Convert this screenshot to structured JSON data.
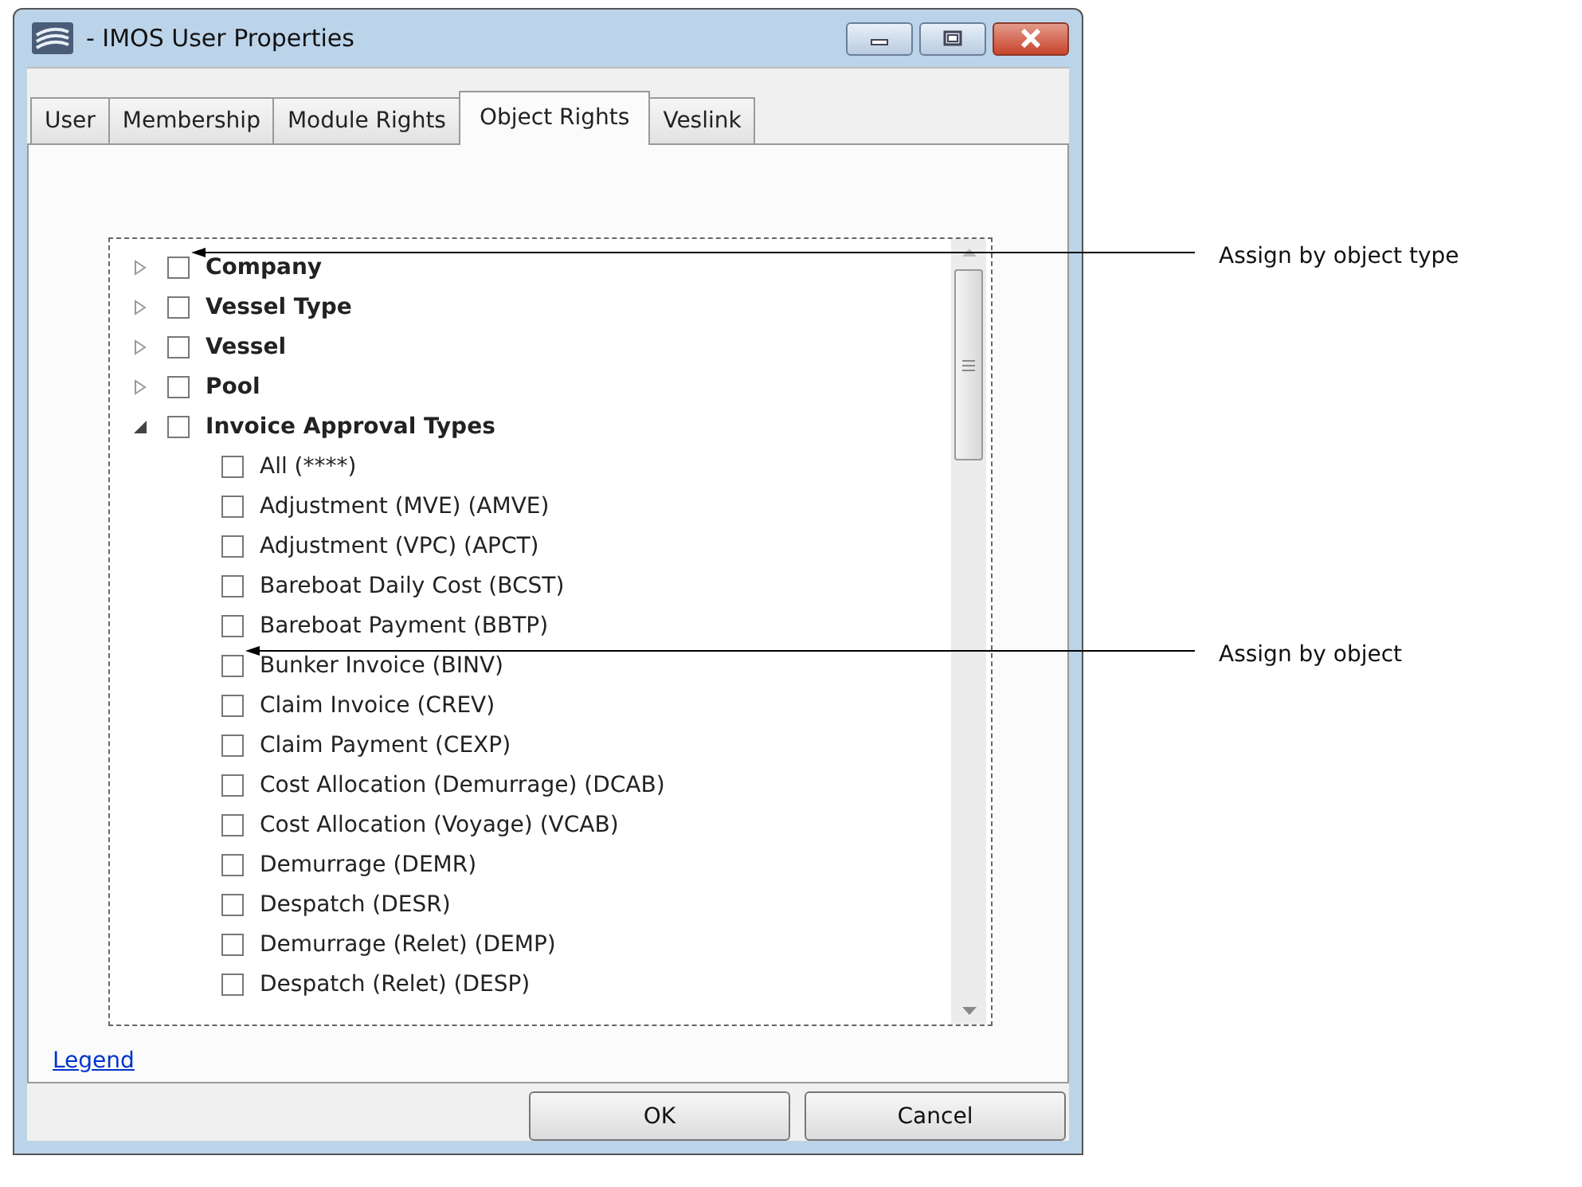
{
  "window": {
    "title": "- IMOS User Properties"
  },
  "tabs": [
    {
      "label": "User",
      "selected": false
    },
    {
      "label": "Membership",
      "selected": false
    },
    {
      "label": "Module Rights",
      "selected": false
    },
    {
      "label": "Object Rights",
      "selected": true
    },
    {
      "label": "Veslink",
      "selected": false
    }
  ],
  "tree": [
    {
      "label": "Company",
      "checked": false,
      "expanded": false,
      "annotation": "Assign by object type"
    },
    {
      "label": "Vessel Type",
      "checked": false,
      "expanded": false
    },
    {
      "label": "Vessel",
      "checked": false,
      "expanded": false
    },
    {
      "label": "Pool",
      "checked": false,
      "expanded": false
    },
    {
      "label": "Invoice Approval Types",
      "checked": false,
      "expanded": true,
      "children": [
        {
          "label": "All (****)",
          "checked": false
        },
        {
          "label": "Adjustment (MVE) (AMVE)",
          "checked": false
        },
        {
          "label": "Adjustment (VPC) (APCT)",
          "checked": false
        },
        {
          "label": "Bareboat Daily Cost (BCST)",
          "checked": false
        },
        {
          "label": "Bareboat Payment (BBTP)",
          "checked": false
        },
        {
          "label": "Bunker Invoice (BINV)",
          "checked": false,
          "annotation": "Assign by object"
        },
        {
          "label": "Claim Invoice (CREV)",
          "checked": false
        },
        {
          "label": "Claim Payment (CEXP)",
          "checked": false
        },
        {
          "label": "Cost Allocation (Demurrage) (DCAB)",
          "checked": false
        },
        {
          "label": "Cost Allocation (Voyage) (VCAB)",
          "checked": false
        },
        {
          "label": "Demurrage (DEMR)",
          "checked": false
        },
        {
          "label": "Despatch (DESR)",
          "checked": false
        },
        {
          "label": "Demurrage (Relet) (DEMP)",
          "checked": false
        },
        {
          "label": "Despatch (Relet) (DESP)",
          "checked": false
        }
      ]
    }
  ],
  "legend_link": "Legend",
  "buttons": [
    "OK",
    "Cancel"
  ]
}
